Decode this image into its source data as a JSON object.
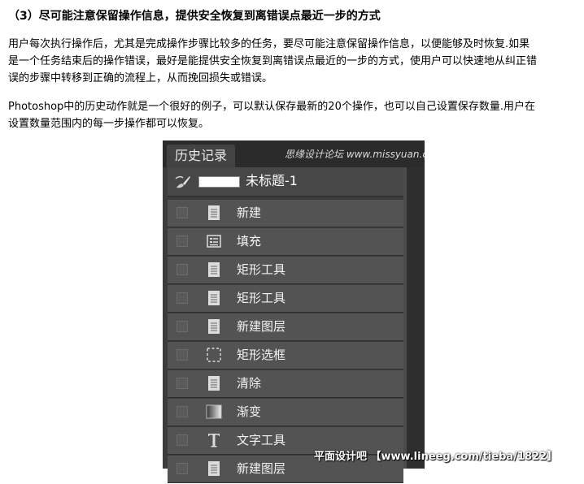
{
  "article": {
    "heading": "（3）尽可能注意保留操作信息，提供安全恢复到离错误点最近一步的方式",
    "paragraph1": [
      "用户每次执行操作后，尤其是完成操作步骤比较多的任务，要尽可能注意保留操作信息，以便能够及时恢复.如果",
      "是一个任务结束后的操作错误，最好是能提供安全恢复到离错误点最近的一步的方式，使用户可以快速地从纠正错",
      "误的步骤中转移到正确的流程上，从而挽回损失或错误。"
    ],
    "paragraph2": [
      "Photoshop中的历史动作就是一个很好的例子，可以默认保存最新的20个操作，也可以自己设置保存数量.用户在",
      "设置数量范围内的每一步操作都可以恢复。"
    ]
  },
  "history_panel": {
    "tab_label": "历史记录",
    "watermark_top": "思缘设计论坛 www.missyuan.com",
    "snapshot": {
      "label": "未标题-1",
      "icon": "history-brush-icon"
    },
    "items": [
      {
        "label": "新建",
        "icon": "document-icon"
      },
      {
        "label": "填充",
        "icon": "fill-icon"
      },
      {
        "label": "矩形工具",
        "icon": "document-icon"
      },
      {
        "label": "矩形工具",
        "icon": "document-icon"
      },
      {
        "label": "新建图层",
        "icon": "document-icon"
      },
      {
        "label": "矩形选框",
        "icon": "marquee-icon"
      },
      {
        "label": "清除",
        "icon": "document-icon"
      },
      {
        "label": "渐变",
        "icon": "gradient-icon"
      },
      {
        "label": "文字工具",
        "icon": "type-icon"
      },
      {
        "label": "新建图层",
        "icon": "document-icon"
      }
    ]
  },
  "watermark_bottom": "平面设计吧 【www.lineeg.com/tieba/1822】",
  "colors": {
    "panel_bg": "#3c3c3c",
    "row_bg": "#535353",
    "text_light": "#f2f2f2"
  }
}
